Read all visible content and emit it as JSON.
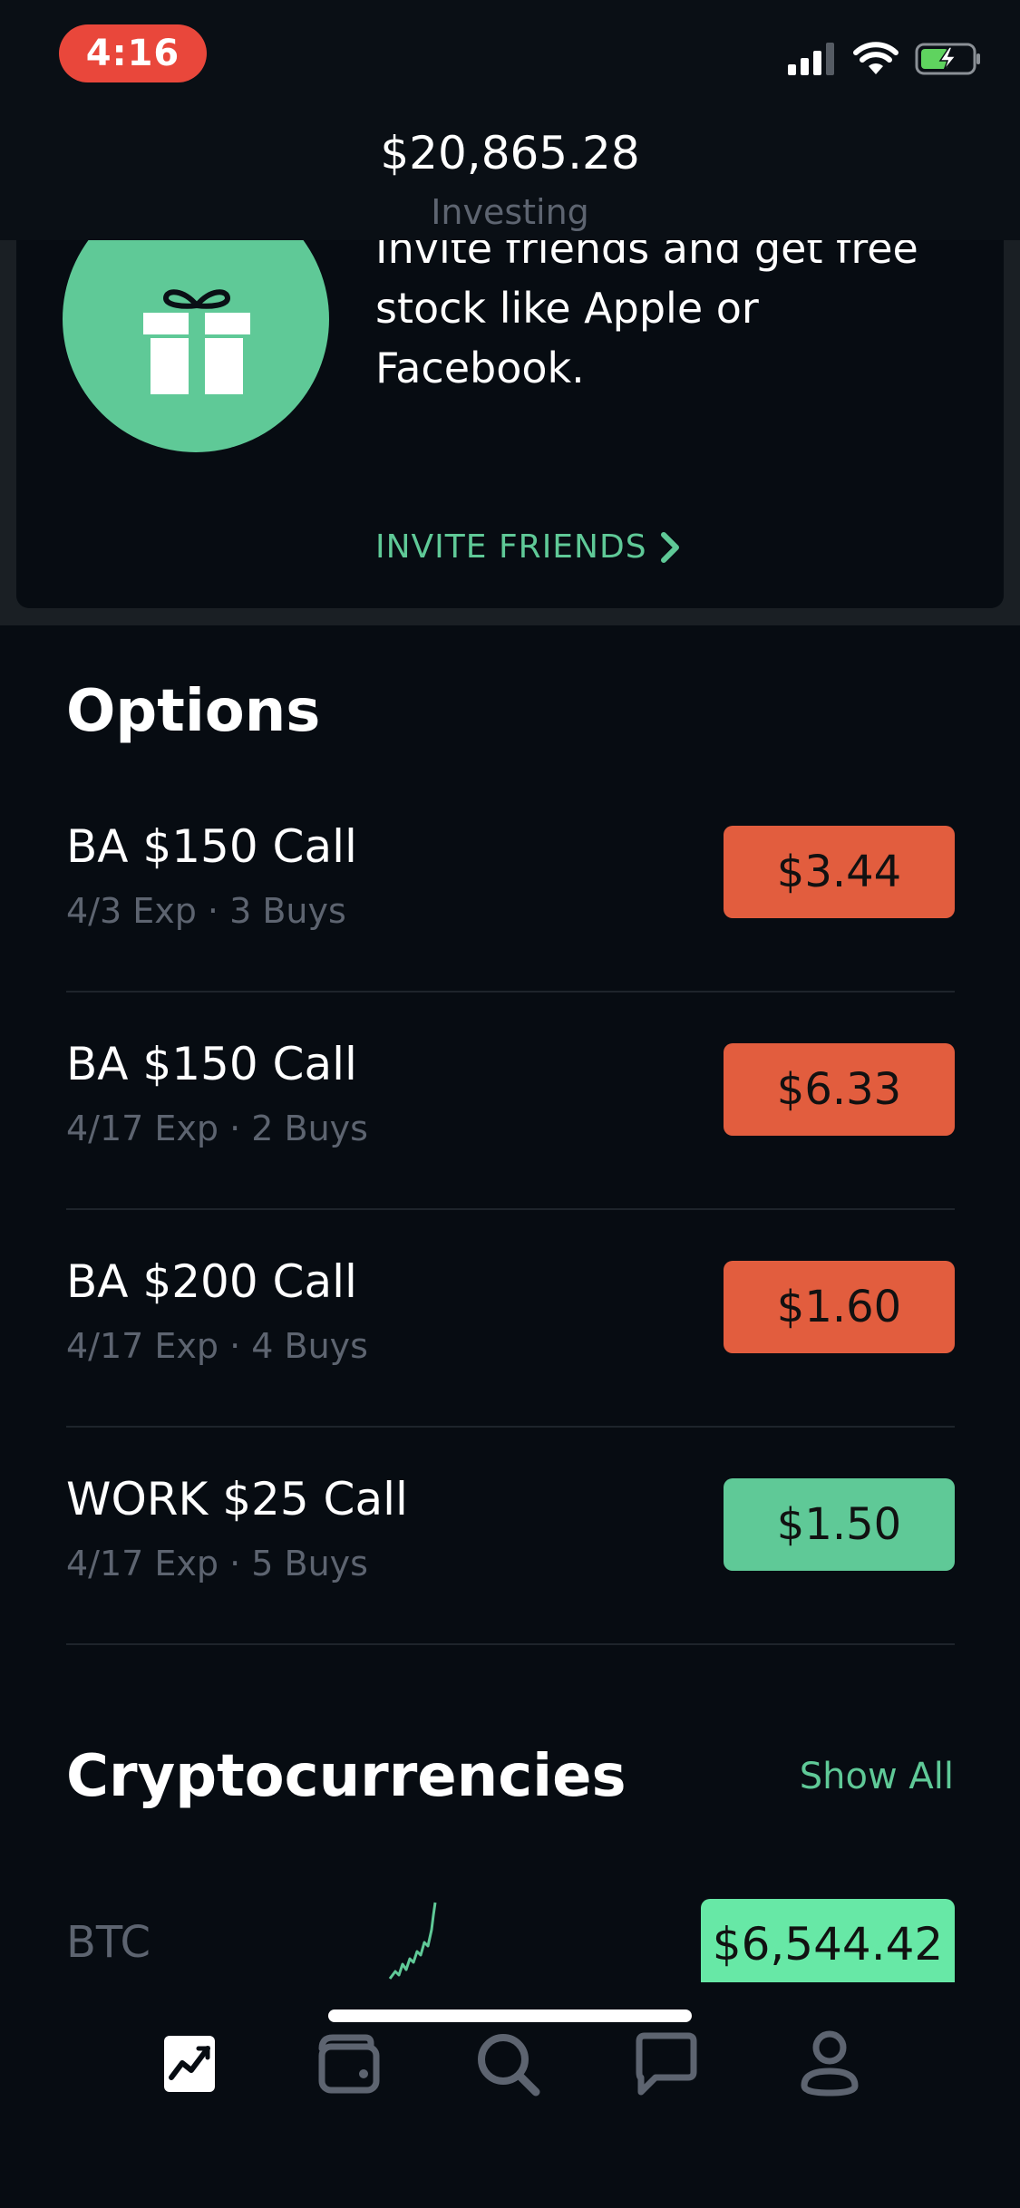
{
  "status_bar": {
    "time": "4:16"
  },
  "header": {
    "amount": "$20,865.28",
    "label": "Investing"
  },
  "invite": {
    "text": "Invite friends and get free stock like Apple or Facebook.",
    "link_label": "INVITE FRIENDS"
  },
  "options": {
    "title": "Options",
    "items": [
      {
        "name": "BA $150 Call",
        "sub": "4/3 Exp · 3 Buys",
        "price": "$3.44",
        "trend": "down"
      },
      {
        "name": "BA $150 Call",
        "sub": "4/17 Exp · 2 Buys",
        "price": "$6.33",
        "trend": "down"
      },
      {
        "name": "BA $200 Call",
        "sub": "4/17 Exp · 4 Buys",
        "price": "$1.60",
        "trend": "down"
      },
      {
        "name": "WORK $25 Call",
        "sub": "4/17 Exp · 5 Buys",
        "price": "$1.50",
        "trend": "up"
      }
    ]
  },
  "crypto": {
    "title": "Cryptocurrencies",
    "show_all": "Show All",
    "items": [
      {
        "symbol": "BTC",
        "price": "$6,544.42"
      }
    ]
  },
  "tab_bar": {
    "tabs": [
      {
        "icon": "chart-icon",
        "active": true
      },
      {
        "icon": "wallet-icon",
        "active": false
      },
      {
        "icon": "search-icon",
        "active": false
      },
      {
        "icon": "chat-icon",
        "active": false
      },
      {
        "icon": "account-icon",
        "active": false
      }
    ]
  },
  "colors": {
    "accent_green": "#5fc997",
    "down_red": "#e25d3e",
    "background": "#070c12"
  }
}
